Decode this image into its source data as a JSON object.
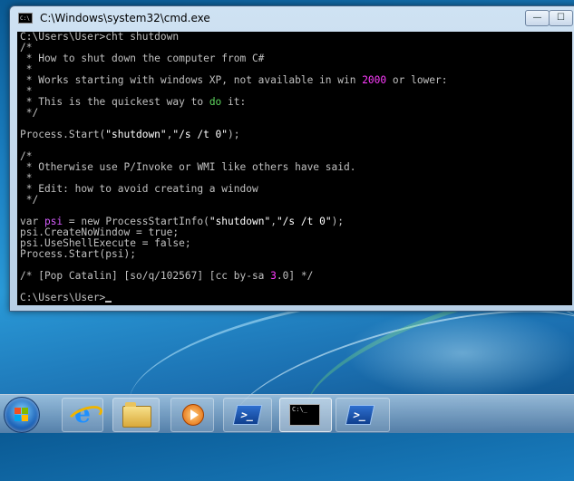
{
  "window": {
    "title": "C:\\Windows\\system32\\cmd.exe",
    "title_icon_text": "C:\\",
    "minimize_glyph": "—",
    "maximize_glyph": "☐"
  },
  "console": {
    "lines": [
      [
        {
          "t": "C:\\Users\\User>cht shutdown"
        }
      ],
      [
        {
          "t": "/*"
        }
      ],
      [
        {
          "t": " * How to shut down the computer from C#"
        }
      ],
      [
        {
          "t": " *"
        }
      ],
      [
        {
          "t": " * Works starting with windows XP, not available in win "
        },
        {
          "t": "2000",
          "c": "num"
        },
        {
          "t": " or lower:"
        }
      ],
      [
        {
          "t": " *"
        }
      ],
      [
        {
          "t": " * This is the quickest way to "
        },
        {
          "t": "do",
          "c": "kw"
        },
        {
          "t": " it:"
        }
      ],
      [
        {
          "t": " */"
        }
      ],
      [
        {
          "t": ""
        }
      ],
      [
        {
          "t": "Process.Start("
        },
        {
          "t": "\"shutdown\"",
          "c": "str"
        },
        {
          "t": ","
        },
        {
          "t": "\"/s /t 0\"",
          "c": "str"
        },
        {
          "t": ");"
        }
      ],
      [
        {
          "t": ""
        }
      ],
      [
        {
          "t": "/*"
        }
      ],
      [
        {
          "t": " * Otherwise use P/Invoke or WMI like others have said."
        }
      ],
      [
        {
          "t": " *"
        }
      ],
      [
        {
          "t": " * Edit: how to avoid creating a window"
        }
      ],
      [
        {
          "t": " */"
        }
      ],
      [
        {
          "t": ""
        }
      ],
      [
        {
          "t": "var "
        },
        {
          "t": "psi",
          "c": "vr"
        },
        {
          "t": " = new ProcessStartInfo("
        },
        {
          "t": "\"shutdown\"",
          "c": "str"
        },
        {
          "t": ","
        },
        {
          "t": "\"/s /t 0\"",
          "c": "str"
        },
        {
          "t": ");"
        }
      ],
      [
        {
          "t": "psi.CreateNoWindow = true;"
        }
      ],
      [
        {
          "t": "psi.UseShellExecute = false;"
        }
      ],
      [
        {
          "t": "Process.Start(psi);"
        }
      ],
      [
        {
          "t": ""
        }
      ],
      [
        {
          "t": "/* [Pop Catalin] [so/q/102567] [cc by-sa "
        },
        {
          "t": "3",
          "c": "num"
        },
        {
          "t": ".0] */"
        }
      ],
      [
        {
          "t": ""
        }
      ],
      [
        {
          "t": "C:\\Users\\User>"
        }
      ]
    ]
  },
  "colors": {
    "string": "#ffffff",
    "keyword": "#5fd75f",
    "number": "#ff3cff",
    "variable": "#d75fff",
    "text": "#c0c0c0"
  },
  "taskbar": {
    "items": [
      {
        "name": "start-button-icon"
      },
      {
        "name": "internet-explorer-icon"
      },
      {
        "name": "windows-explorer-icon"
      },
      {
        "name": "media-player-icon"
      },
      {
        "name": "powershell-icon"
      },
      {
        "name": "cmd-icon",
        "icon_text": "C:\\_"
      },
      {
        "name": "powershell-icon-2"
      }
    ]
  }
}
